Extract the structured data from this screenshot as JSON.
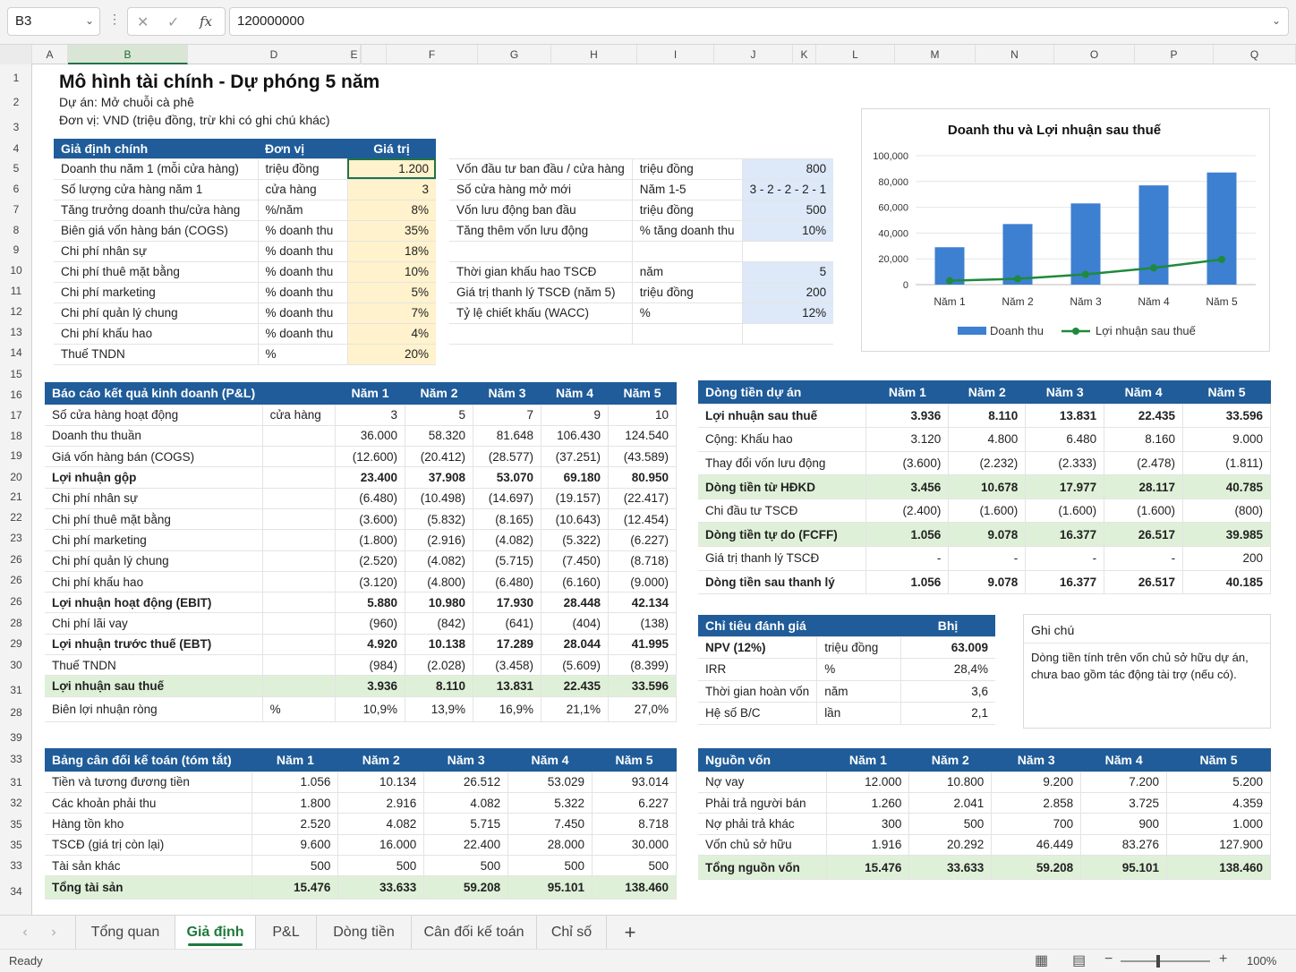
{
  "formula_bar": {
    "cell_ref": "B3",
    "formula": "120000000",
    "fx_label": "fx"
  },
  "columns": [
    "A",
    "B",
    "D",
    "E",
    "F",
    "G",
    "H",
    "I",
    "J",
    "K",
    "L",
    "M",
    "N",
    "O",
    "P",
    "Q"
  ],
  "rows": [
    "1",
    "2",
    "3",
    "4",
    "5",
    "6",
    "7",
    "8",
    "9",
    "10",
    "11",
    "12",
    "13",
    "14",
    "15",
    "16",
    "17",
    "18",
    "19",
    "20",
    "21",
    "22",
    "23",
    "26",
    "26",
    "26",
    "28",
    "29",
    "30",
    "31",
    "28",
    "39",
    "33",
    "31",
    "32",
    "35",
    "35",
    "33",
    "34"
  ],
  "header": {
    "title": "Mô hình tài chính - Dự phóng 5 năm",
    "project": "Dự án: Mở chuỗi cà phê",
    "unit": "Đơn vị: VND (triệu đồng, trừ khi có ghi chú khác)"
  },
  "assumptions": {
    "headers": [
      "Giả định chính",
      "Đơn vị",
      "Giá trị"
    ],
    "rows": [
      [
        "Doanh thu năm 1 (mỗi cửa hàng)",
        "triệu đồng",
        "1.200"
      ],
      [
        "Số lượng cửa hàng năm 1",
        "cửa hàng",
        "3"
      ],
      [
        "Tăng trưởng doanh thu/cửa hàng",
        "%/năm",
        "8%"
      ],
      [
        "Biên giá vốn hàng bán (COGS)",
        "% doanh thu",
        "35%"
      ],
      [
        "Chi phí nhân sự",
        "% doanh thu",
        "18%"
      ],
      [
        "Chi phí thuê mặt bằng",
        "% doanh thu",
        "10%"
      ],
      [
        "Chi phí marketing",
        "% doanh thu",
        "5%"
      ],
      [
        "Chi phí quản lý chung",
        "% doanh thu",
        "7%"
      ],
      [
        "Chi phí khấu hao",
        "% doanh thu",
        "4%"
      ],
      [
        "Thuế TNDN",
        "%",
        "20%"
      ]
    ]
  },
  "invest": {
    "rows": [
      [
        "Vốn đầu tư ban đầu / cửa hàng",
        "triệu đồng",
        "800"
      ],
      [
        "Số cửa hàng mở mới",
        "Năm 1-5",
        "3 - 2 - 2 - 2 - 1"
      ],
      [
        "Vốn lưu động ban đầu",
        "triệu đồng",
        "500"
      ],
      [
        "Tăng thêm vốn lưu động",
        "% tăng doanh thu",
        "10%"
      ],
      [
        "",
        "",
        ""
      ],
      [
        "Thời gian khấu hao TSCĐ",
        "năm",
        "5"
      ],
      [
        "Giá trị thanh lý TSCĐ (năm 5)",
        "triệu đồng",
        "200"
      ],
      [
        "Tỷ lệ chiết khấu (WACC)",
        "%",
        "12%"
      ],
      [
        "",
        "",
        ""
      ]
    ]
  },
  "chart_data": {
    "type": "bar",
    "title": "Doanh thu và Lợi nhuận sau thuế",
    "categories": [
      "Năm 1",
      "Năm 2",
      "Năm 3",
      "Năm 4",
      "Năm 5"
    ],
    "ylim": [
      0,
      100000
    ],
    "yticks": [
      "0",
      "20,000",
      "40,000",
      "60,000",
      "80,000",
      "100,000"
    ],
    "series": [
      {
        "name": "Doanh thu",
        "kind": "bar",
        "color": "#3d7fd1",
        "values": [
          29000,
          47000,
          63000,
          77000,
          87000
        ]
      },
      {
        "name": "Lợi nhuận sau thuế",
        "kind": "line",
        "color": "#1e8a3c",
        "values": [
          3000,
          4500,
          8000,
          13000,
          19500
        ]
      }
    ],
    "legend": "bottom"
  },
  "pl": {
    "headers": [
      "Báo cáo kết quả kinh doanh (P&L)",
      "",
      "Năm 1",
      "Năm 2",
      "Năm 3",
      "Năm 4",
      "Năm 5"
    ],
    "rows": [
      {
        "label": "Số cửa hàng hoạt động",
        "unit": "cửa hàng",
        "v": [
          "3",
          "5",
          "7",
          "9",
          "10"
        ],
        "style": ""
      },
      {
        "label": "Doanh thu thuần",
        "unit": "",
        "v": [
          "36.000",
          "58.320",
          "81.648",
          "106.430",
          "124.540"
        ],
        "style": ""
      },
      {
        "label": "Giá vốn hàng bán (COGS)",
        "unit": "",
        "v": [
          "(12.600)",
          "(20.412)",
          "(28.577)",
          "(37.251)",
          "(43.589)"
        ],
        "style": ""
      },
      {
        "label": "Lợi nhuận gộp",
        "unit": "",
        "v": [
          "23.400",
          "37.908",
          "53.070",
          "69.180",
          "80.950"
        ],
        "style": "b"
      },
      {
        "label": "Chi phí nhân sự",
        "unit": "",
        "v": [
          "(6.480)",
          "(10.498)",
          "(14.697)",
          "(19.157)",
          "(22.417)"
        ],
        "style": ""
      },
      {
        "label": "Chi phí thuê mặt bằng",
        "unit": "",
        "v": [
          "(3.600)",
          "(5.832)",
          "(8.165)",
          "(10.643)",
          "(12.454)"
        ],
        "style": ""
      },
      {
        "label": "Chi phí marketing",
        "unit": "",
        "v": [
          "(1.800)",
          "(2.916)",
          "(4.082)",
          "(5.322)",
          "(6.227)"
        ],
        "style": ""
      },
      {
        "label": "Chi phí quản lý chung",
        "unit": "",
        "v": [
          "(2.520)",
          "(4.082)",
          "(5.715)",
          "(7.450)",
          "(8.718)"
        ],
        "style": ""
      },
      {
        "label": "Chi phí khấu hao",
        "unit": "",
        "v": [
          "(3.120)",
          "(4.800)",
          "(6.480)",
          "(6.160)",
          "(9.000)"
        ],
        "style": ""
      },
      {
        "label": "Lợi nhuận hoạt động (EBIT)",
        "unit": "",
        "v": [
          "5.880",
          "10.980",
          "17.930",
          "28.448",
          "42.134"
        ],
        "style": "b"
      },
      {
        "label": "Chi phí lãi vay",
        "unit": "",
        "v": [
          "(960)",
          "(842)",
          "(641)",
          "(404)",
          "(138)"
        ],
        "style": ""
      },
      {
        "label": "Lợi nhuận trước thuế (EBT)",
        "unit": "",
        "v": [
          "4.920",
          "10.138",
          "17.289",
          "28.044",
          "41.995"
        ],
        "style": "b"
      },
      {
        "label": "Thuế TNDN",
        "unit": "",
        "v": [
          "(984)",
          "(2.028)",
          "(3.458)",
          "(5.609)",
          "(8.399)"
        ],
        "style": ""
      },
      {
        "label": "Lợi nhuận sau thuế",
        "unit": "",
        "v": [
          "3.936",
          "8.110",
          "13.831",
          "22.435",
          "33.596"
        ],
        "style": "hl"
      },
      {
        "label": "Biên lợi nhuận ròng",
        "unit": "%",
        "v": [
          "10,9%",
          "13,9%",
          "16,9%",
          "21,1%",
          "27,0%"
        ],
        "style": ""
      }
    ]
  },
  "cashflow": {
    "headers": [
      "Dòng tiền dự án",
      "Năm 1",
      "Năm 2",
      "Năm 3",
      "Năm 4",
      "Năm 5"
    ],
    "rows": [
      {
        "label": "Lợi nhuận sau thuế",
        "v": [
          "3.936",
          "8.110",
          "13.831",
          "22.435",
          "33.596"
        ],
        "style": "b"
      },
      {
        "label": "Cộng: Khấu hao",
        "v": [
          "3.120",
          "4.800",
          "6.480",
          "8.160",
          "9.000"
        ],
        "style": ""
      },
      {
        "label": "Thay đổi vốn lưu động",
        "v": [
          "(3.600)",
          "(2.232)",
          "(2.333)",
          "(2.478)",
          "(1.811)"
        ],
        "style": ""
      },
      {
        "label": "Dòng tiền từ HĐKD",
        "v": [
          "3.456",
          "10.678",
          "17.977",
          "28.117",
          "40.785"
        ],
        "style": "hl"
      },
      {
        "label": "Chi đầu tư TSCĐ",
        "v": [
          "(2.400)",
          "(1.600)",
          "(1.600)",
          "(1.600)",
          "(800)"
        ],
        "style": ""
      },
      {
        "label": "Dòng tiền tự do (FCFF)",
        "v": [
          "1.056",
          "9.078",
          "16.377",
          "26.517",
          "39.985"
        ],
        "style": "hl"
      },
      {
        "label": "Giá trị thanh lý TSCĐ",
        "v": [
          "-",
          "-",
          "-",
          "-",
          "200"
        ],
        "style": ""
      },
      {
        "label": "Dòng tiền sau thanh lý",
        "v": [
          "1.056",
          "9.078",
          "16.377",
          "26.517",
          "40.185"
        ],
        "style": "b"
      }
    ]
  },
  "metrics": {
    "headers": [
      "Chỉ tiêu đánh giá",
      "",
      "Bhị"
    ],
    "rows": [
      {
        "label": "NPV (12%)",
        "unit": "triệu đồng",
        "v": "63.009",
        "style": "b"
      },
      {
        "label": "IRR",
        "unit": "%",
        "v": "28,4%",
        "style": ""
      },
      {
        "label": "Thời gian hoàn vốn",
        "unit": "năm",
        "v": "3,6",
        "style": ""
      },
      {
        "label": "Hệ số B/C",
        "unit": "lần",
        "v": "2,1",
        "style": ""
      }
    ]
  },
  "note": {
    "title": "Ghi chú",
    "text": "Dòng tiền tính trên vốn chủ sở hữu dự án, chưa bao gồm tác động tài trợ (nếu có)."
  },
  "balance": {
    "headers": [
      "Bảng cân đối kế toán (tóm tắt)",
      "Năm 1",
      "Năm 2",
      "Năm 3",
      "Năm 4",
      "Năm 5"
    ],
    "rows": [
      {
        "label": "Tiền và tương đương tiền",
        "v": [
          "1.056",
          "10.134",
          "26.512",
          "53.029",
          "93.014"
        ],
        "style": ""
      },
      {
        "label": "Các khoản phải thu",
        "v": [
          "1.800",
          "2.916",
          "4.082",
          "5.322",
          "6.227"
        ],
        "style": ""
      },
      {
        "label": "Hàng tồn kho",
        "v": [
          "2.520",
          "4.082",
          "5.715",
          "7.450",
          "8.718"
        ],
        "style": ""
      },
      {
        "label": "TSCĐ (giá trị còn lại)",
        "v": [
          "9.600",
          "16.000",
          "22.400",
          "28.000",
          "30.000"
        ],
        "style": ""
      },
      {
        "label": "Tài sản khác",
        "v": [
          "500",
          "500",
          "500",
          "500",
          "500"
        ],
        "style": ""
      },
      {
        "label": "Tổng tài sản",
        "v": [
          "15.476",
          "33.633",
          "59.208",
          "95.101",
          "138.460"
        ],
        "style": "hl"
      }
    ]
  },
  "funding": {
    "headers": [
      "Nguồn vốn",
      "Năm 1",
      "Năm 2",
      "Năm 3",
      "Năm 4",
      "Năm 5"
    ],
    "rows": [
      {
        "label": "Nợ vay",
        "v": [
          "12.000",
          "10.800",
          "9.200",
          "7.200",
          "5.200"
        ],
        "style": ""
      },
      {
        "label": "Phải trả người bán",
        "v": [
          "1.260",
          "2.041",
          "2.858",
          "3.725",
          "4.359"
        ],
        "style": ""
      },
      {
        "label": "Nợ phải trả khác",
        "v": [
          "300",
          "500",
          "700",
          "900",
          "1.000"
        ],
        "style": ""
      },
      {
        "label": "Vốn chủ sở hữu",
        "v": [
          "1.916",
          "20.292",
          "46.449",
          "83.276",
          "127.900"
        ],
        "style": ""
      },
      {
        "label": "Tổng nguồn vốn",
        "v": [
          "15.476",
          "33.633",
          "59.208",
          "95.101",
          "138.460"
        ],
        "style": "hl"
      }
    ]
  },
  "tabs": [
    "Tổng quan",
    "Giả định",
    "P&L",
    "Dòng tiền",
    "Cân đối kế toán",
    "Chỉ số"
  ],
  "active_tab": "Giả định",
  "add_sheet": "+",
  "status": {
    "ready": "Ready",
    "zoom": "100%"
  },
  "colors": {
    "header_blue": "#1f5c99",
    "highlight_green": "#dff0d8",
    "input_yellow": "#fff2cc",
    "input_blue": "#dde9f8",
    "excel_green": "#217346"
  }
}
